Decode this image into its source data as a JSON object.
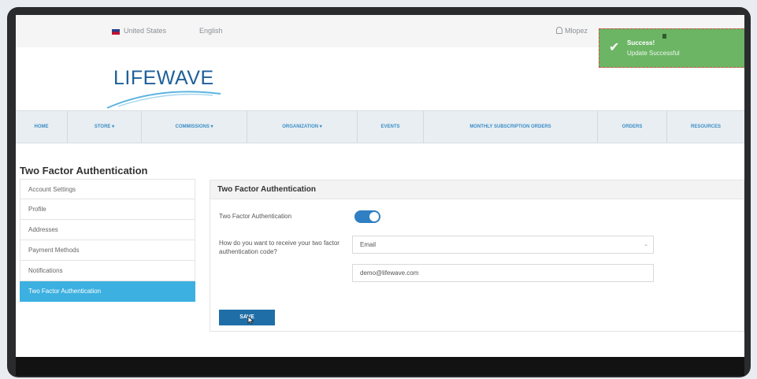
{
  "topbar": {
    "country": "United States",
    "language": "English",
    "user": "Mlopez"
  },
  "logo": {
    "text": "LIFEWAVE"
  },
  "nav": {
    "items": [
      "HOME",
      "STORE ▾",
      "COMMISSIONS ▾",
      "ORGANIZATION ▾",
      "EVENTS",
      "MONTHLY SUBSCRIPTION ORDERS",
      "ORDERS",
      "RESOURCES"
    ]
  },
  "page": {
    "title": "Two Factor Authentication"
  },
  "sidebar": {
    "items": [
      {
        "label": "Account Settings"
      },
      {
        "label": "Profile"
      },
      {
        "label": "Addresses"
      },
      {
        "label": "Payment Methods"
      },
      {
        "label": "Notifications"
      },
      {
        "label": "Two Factor Authentication"
      }
    ],
    "active_index": 5
  },
  "panel": {
    "title": "Two Factor Authentication",
    "toggle_label": "Two Factor Authentication",
    "toggle_on": true,
    "method_label": "How do you want to receive your two factor authentication code?",
    "method_value": "Email",
    "email_value": "demo@lifewave.com",
    "save_label": "SAVE"
  },
  "toast": {
    "title": "Success!",
    "message": "Update Successful"
  },
  "colors": {
    "accent": "#3cb0e0",
    "button": "#1f6ea8",
    "toast": "#6cb565"
  }
}
